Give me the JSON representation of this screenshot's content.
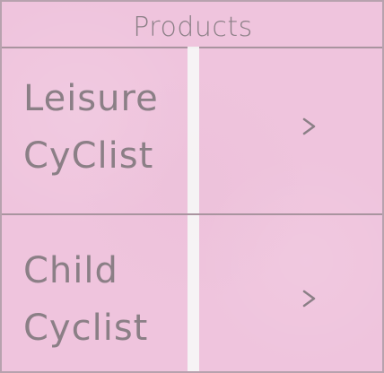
{
  "header": {
    "title": "Products"
  },
  "items": [
    {
      "label": "Leisure\nCyClist",
      "chevron": ">"
    },
    {
      "label": "Child\nCyclist",
      "chevron": ">"
    }
  ],
  "colors": {
    "background": "#efc4dd",
    "line": "#a9949f",
    "text": "#8b7f86",
    "divider": "#f6f6f6"
  }
}
